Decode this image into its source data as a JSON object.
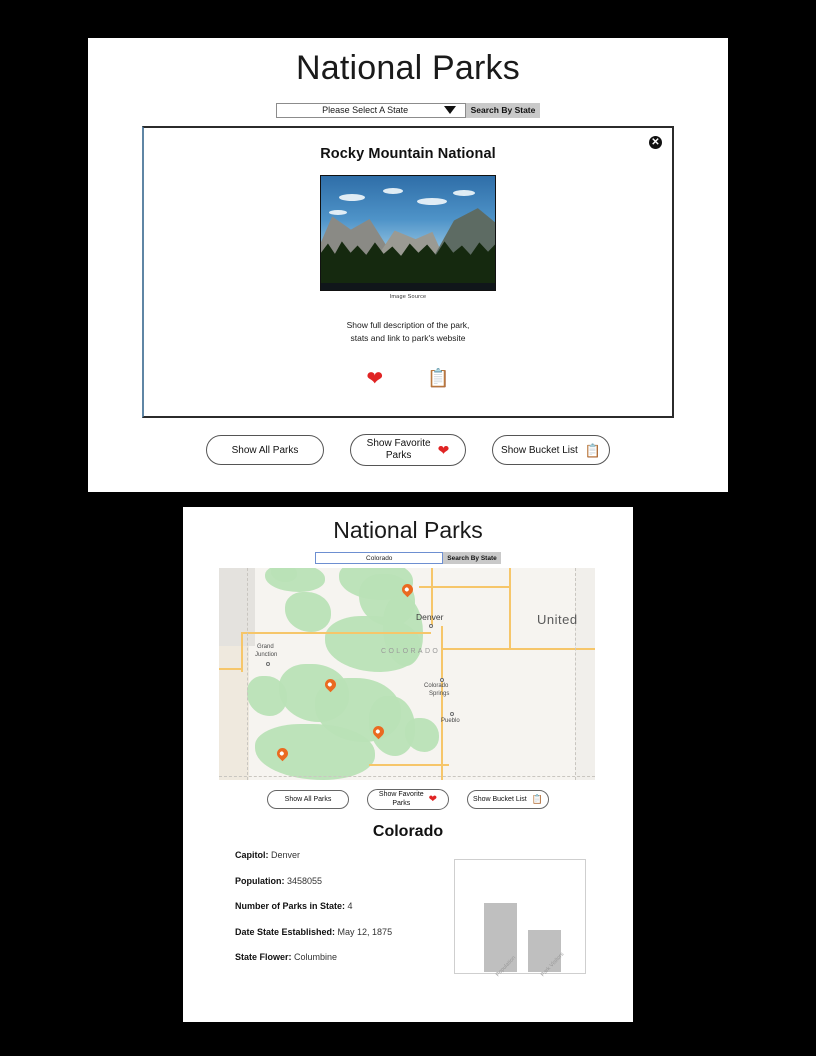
{
  "panel1": {
    "title": "National Parks",
    "search": {
      "select_value": "Please Select A State",
      "caret_icon": "chevron-down-icon",
      "button_label": "Search By State"
    },
    "card": {
      "close_icon": "close-icon",
      "park_title": "Rocky Mountain National",
      "image_caption": "Image Source",
      "description_line1": "Show full description of the park,",
      "description_line2": "stats and link to park's website",
      "favorite_icon": "heart-icon",
      "bucket_icon": "clipboard-icon"
    },
    "buttons": {
      "all_parks": "Show All Parks",
      "favorite_line1": "Show Favorite",
      "favorite_line2": "Parks",
      "favorite_icon": "heart-icon",
      "bucket": "Show Bucket List",
      "bucket_icon": "clipboard-icon"
    }
  },
  "panel2": {
    "title": "National Parks",
    "search": {
      "input_value": "Colorado",
      "button_label": "Search By State"
    },
    "map": {
      "state_label": "COLORADO",
      "country_label": "United",
      "cities": [
        {
          "name": "Denver"
        },
        {
          "name": "Grand",
          "name2": "Junction"
        },
        {
          "name": "Colorado",
          "name2": "Springs"
        },
        {
          "name": "Pueblo"
        }
      ],
      "marker_count": 4,
      "marker_icon": "map-pin-icon"
    },
    "buttons": {
      "all_parks": "Show All Parks",
      "favorite_line1": "Show Favorite",
      "favorite_line2": "Parks",
      "favorite_icon": "heart-icon",
      "bucket": "Show Bucket List",
      "bucket_icon": "clipboard-icon"
    },
    "state_heading": "Colorado",
    "facts": [
      {
        "label": "Capitol:",
        "value": " Denver"
      },
      {
        "label": "Population:",
        "value": " 3458055"
      },
      {
        "label": "Number of Parks in State:",
        "value": " 4"
      },
      {
        "label": "Date State Established:",
        "value": " May 12, 1875"
      },
      {
        "label": "State Flower:",
        "value": " Columbine"
      }
    ]
  },
  "chart_data": {
    "type": "bar",
    "categories": [
      "Population",
      "Park Visitors"
    ],
    "values": [
      62,
      38
    ],
    "title": "",
    "xlabel": "",
    "ylabel": "",
    "ylim": [
      0,
      100
    ],
    "grid": false,
    "legend": "none",
    "bar_color": "#bfbfbf"
  },
  "colors": {
    "accent_red": "#e02424",
    "accent_green": "#3da13d",
    "pin_orange": "#ea6a20",
    "button_gray": "#c9c9c9",
    "bar_gray": "#bfbfbf"
  }
}
